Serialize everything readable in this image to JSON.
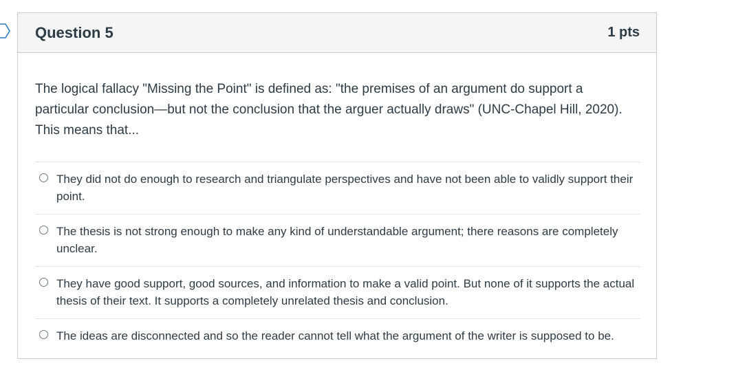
{
  "question": {
    "title": "Question 5",
    "points": "1 pts",
    "text": "The logical fallacy \"Missing the Point\" is defined as: \"the premises of an argument do support a particular conclusion—but not the conclusion that the arguer actually draws\" (UNC-Chapel Hill, 2020). This means that...",
    "answers": [
      {
        "label": "They did not do enough to research and triangulate perspectives and have not been able to validly support their point."
      },
      {
        "label": "The thesis is not strong enough to make any kind of understandable argument; there reasons are completely unclear."
      },
      {
        "label": "They have good support, good sources, and information to make a valid point. But none of it supports the actual thesis of their text. It supports a completely unrelated thesis and conclusion."
      },
      {
        "label": "The ideas are disconnected and so the reader cannot tell what the argument of the writer is supposed to be."
      }
    ]
  },
  "icons": {
    "flag": "question-flag-icon",
    "radio": "radio-unchecked-icon"
  },
  "colors": {
    "text": "#2d3b45",
    "header_bg": "#f5f5f5",
    "border": "#c7cdd1"
  }
}
